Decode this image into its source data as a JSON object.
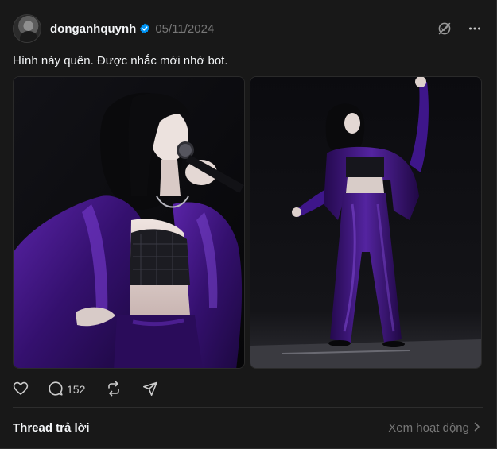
{
  "post": {
    "username": "donganhquynh",
    "date": "05/11/2024",
    "caption": "Hình này quên. Được nhắc mới nhớ bot.",
    "reply_count": "152"
  },
  "footer": {
    "thread_label": "Thread trả lời",
    "activity_label": "Xem hoạt động"
  },
  "colors": {
    "background": "#181818",
    "text_primary": "#f3f5f7",
    "text_secondary": "#777777",
    "verified_blue": "#0095f6",
    "velvet_purple": "#3b1479"
  },
  "icons": {
    "verified": "verified-badge-icon",
    "hide": "eye-slash-icon",
    "more": "more-horizontal-icon",
    "like": "heart-icon",
    "reply": "comment-icon",
    "repost": "repost-icon",
    "share": "send-icon",
    "chevron": "chevron-right-icon"
  }
}
